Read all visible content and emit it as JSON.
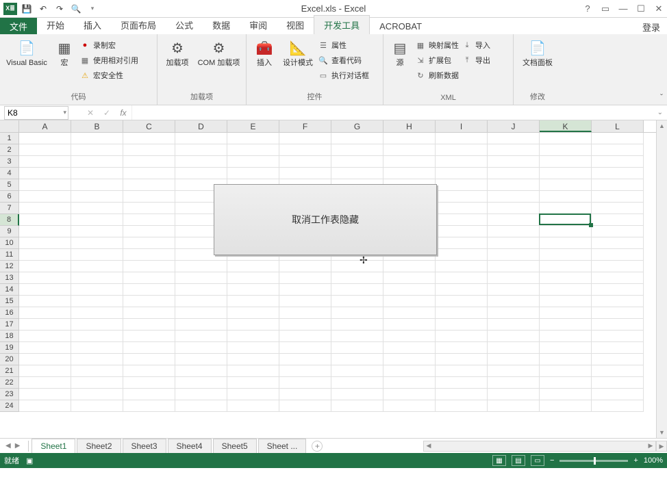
{
  "title": "Excel.xls - Excel",
  "login": "登录",
  "tabs": {
    "file": "文件",
    "items": [
      "开始",
      "插入",
      "页面布局",
      "公式",
      "数据",
      "审阅",
      "视图",
      "开发工具",
      "ACROBAT"
    ],
    "active_index": 7
  },
  "ribbon": {
    "code": {
      "label": "代码",
      "vb": "Visual Basic",
      "macro": "宏",
      "record": "录制宏",
      "relative": "使用相对引用",
      "safety": "宏安全性"
    },
    "addin": {
      "label": "加载项",
      "addin": "加载项",
      "com": "COM 加载项"
    },
    "ctrl": {
      "label": "控件",
      "insert": "插入",
      "design": "设计模式",
      "props": "属性",
      "viewcode": "查看代码",
      "dialog": "执行对话框"
    },
    "xml": {
      "label": "XML",
      "src": "源",
      "mapprops": "映射属性",
      "expack": "扩展包",
      "refresh": "刷新数据",
      "import": "导入",
      "export": "导出"
    },
    "modify": {
      "label": "修改",
      "docpanel": "文档面板"
    }
  },
  "namebox": "K8",
  "columns": [
    "A",
    "B",
    "C",
    "D",
    "E",
    "F",
    "G",
    "H",
    "I",
    "J",
    "K",
    "L"
  ],
  "rows": 24,
  "selected": {
    "col": 10,
    "row": 7
  },
  "shape": {
    "text": "取消工作表隐藏"
  },
  "sheets": {
    "items": [
      "Sheet1",
      "Sheet2",
      "Sheet3",
      "Sheet4",
      "Sheet5",
      "Sheet  ..."
    ],
    "active": 0
  },
  "status": {
    "ready": "就绪",
    "zoom": "100%"
  }
}
